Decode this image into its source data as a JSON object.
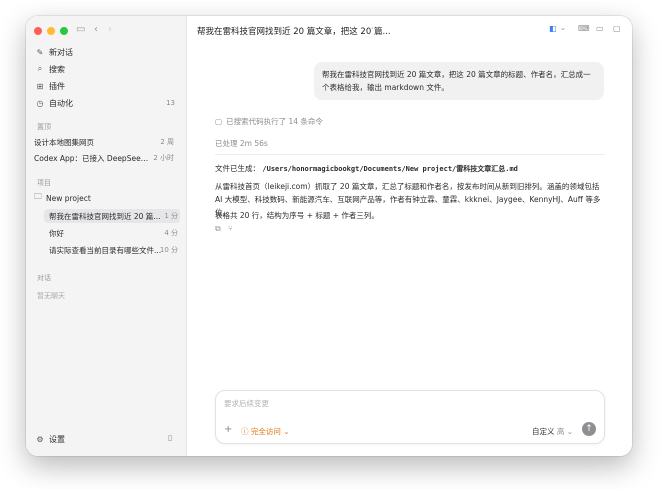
{
  "sidebar": {
    "nav": [
      {
        "icon": "new-chat-icon",
        "glyph": "✎",
        "label": "新对话"
      },
      {
        "icon": "search-icon",
        "glyph": "⌕",
        "label": "搜索"
      },
      {
        "icon": "plugin-icon",
        "glyph": "⊞",
        "label": "插件"
      },
      {
        "icon": "automation-icon",
        "glyph": "◷",
        "label": "自动化",
        "badge": "13"
      }
    ],
    "section_pinned": "置顶",
    "pinned": [
      {
        "title": "设计本地图集网页",
        "time": "2 周"
      },
      {
        "title": "Codex App：已接入 DeepSeek V...",
        "time": "2 小时"
      }
    ],
    "section_projects": "项目",
    "project_name": "New project",
    "project_items": [
      {
        "title": "帮我在雷科技官网找到近 20 篇...",
        "time": "1 分"
      },
      {
        "title": "你好",
        "time": "4 分"
      },
      {
        "title": "请实际查看当前目录有哪些文件...",
        "time": "10 分"
      }
    ],
    "section_chats": "对话",
    "no_chats": "暂无聊天",
    "settings_label": "设置"
  },
  "header": {
    "title": "帮我在雷科技官网找到近 20 篇文章，把这 20 篇...",
    "more": "···"
  },
  "chat": {
    "user_message": "帮我在雷科技官网找到近 20 篇文章，把这 20 篇文章的标题、作者名，汇总成一个表格给我，输出 markdown 文件。",
    "ran_commands": "已搜索代码执行了 14 条命令",
    "processed": "已处理 2m 56s",
    "file_prefix": "文件已生成：",
    "file_path": "/Users/honormagicbookgt/Documents/New project/雷科技文章汇总.md",
    "paragraph1": "从雷科技首页（leikeji.com）抓取了 20 篇文章，汇总了标题和作者名，按发布时间从新到旧排列。涵盖的领域包括 AI 大模型、科技数码、新能源汽车、互联网产品等，作者有钟立霖、童霖、kkknei、Jaygee、KennyHJ、Auff 等多位。",
    "paragraph2": "表格共 20 行，结构为序号 + 标题 + 作者三列。"
  },
  "composer": {
    "placeholder": "要求后续变更",
    "access_label": "完全访问",
    "model_label": "自定义",
    "effort_label": "高"
  },
  "colors": {
    "accent_orange": "#d9730d",
    "send_button": "#8e8e93",
    "close": "#ff5f57",
    "minimize": "#febc2e",
    "zoom": "#28c840"
  }
}
